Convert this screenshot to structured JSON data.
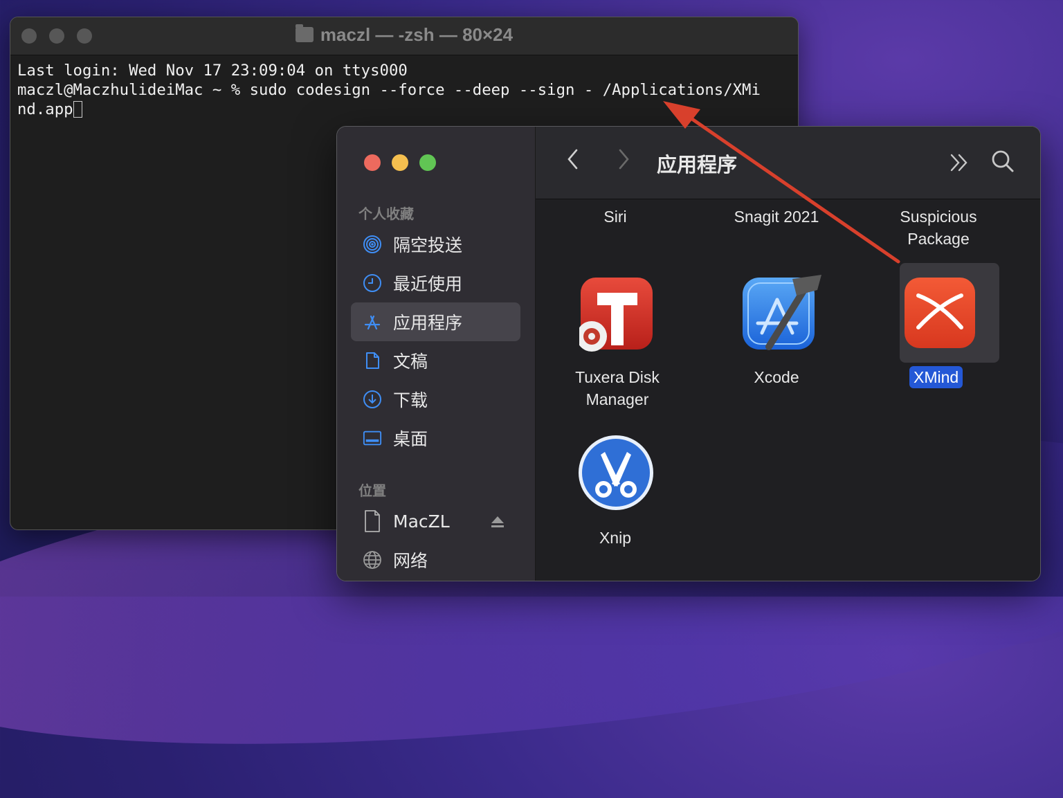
{
  "terminal": {
    "title": "maczl — -zsh — 80×24",
    "lines": [
      "Last login: Wed Nov 17 23:09:04 on ttys000",
      "maczl@MaczhulideiMac ~ % sudo codesign --force --deep --sign - /Applications/XMi",
      "nd.app"
    ]
  },
  "finder": {
    "title": "应用程序",
    "sidebar": {
      "favorites_header": "个人收藏",
      "favorites": [
        {
          "label": "隔空投送",
          "icon": "airdrop-icon"
        },
        {
          "label": "最近使用",
          "icon": "clock-icon"
        },
        {
          "label": "应用程序",
          "icon": "applications-icon",
          "active": true
        },
        {
          "label": "文稿",
          "icon": "document-icon"
        },
        {
          "label": "下载",
          "icon": "download-icon"
        },
        {
          "label": "桌面",
          "icon": "desktop-icon"
        }
      ],
      "locations_header": "位置",
      "locations": [
        {
          "label": "MacZL",
          "icon": "disk-icon"
        },
        {
          "label": "网络",
          "icon": "network-icon"
        }
      ]
    },
    "top_row_labels": [
      "Siri",
      "Snagit 2021",
      "Suspicious\nPackage"
    ],
    "apps": [
      {
        "label": "Tuxera Disk\nManager",
        "icon": "tuxera-icon"
      },
      {
        "label": "Xcode",
        "icon": "xcode-icon"
      },
      {
        "label": "XMind",
        "icon": "xmind-icon",
        "selected": true
      },
      {
        "label": "Xnip",
        "icon": "xnip-icon"
      }
    ]
  },
  "colors": {
    "annotation_arrow": "#d8402c",
    "selection": "#2458d6",
    "xmind_red": "#e8492b"
  }
}
